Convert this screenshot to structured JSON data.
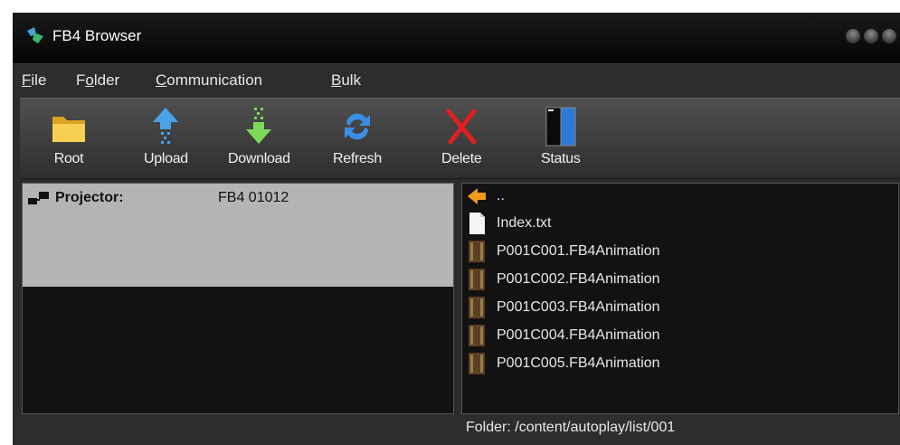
{
  "window": {
    "title": "FB4 Browser"
  },
  "menu": [
    {
      "accel": "F",
      "rest": "ile"
    },
    {
      "pre": "F",
      "accel": "o",
      "rest": "lder"
    },
    {
      "accel": "C",
      "rest": "ommunication"
    },
    {
      "accel": "B",
      "rest": "ulk"
    }
  ],
  "toolbar": {
    "root": "Root",
    "upload": "Upload",
    "download": "Download",
    "refresh": "Refresh",
    "delete": "Delete",
    "status": "Status"
  },
  "projector": {
    "label": "Projector:",
    "value": "FB4 01012"
  },
  "files": [
    {
      "name": "..",
      "icon": "back-arrow-icon"
    },
    {
      "name": "Index.txt",
      "icon": "text-file-icon"
    },
    {
      "name": "P001C001.FB4Animation",
      "icon": "animation-file-icon"
    },
    {
      "name": "P001C002.FB4Animation",
      "icon": "animation-file-icon"
    },
    {
      "name": "P001C003.FB4Animation",
      "icon": "animation-file-icon"
    },
    {
      "name": "P001C004.FB4Animation",
      "icon": "animation-file-icon"
    },
    {
      "name": "P001C005.FB4Animation",
      "icon": "animation-file-icon"
    }
  ],
  "status": {
    "folder": "Folder:  /content/autoplay/list/001"
  },
  "colors": {
    "selected_row": "#b4b4b4",
    "pane_bg": "#121212",
    "window_bg": "#2b2b2b"
  }
}
